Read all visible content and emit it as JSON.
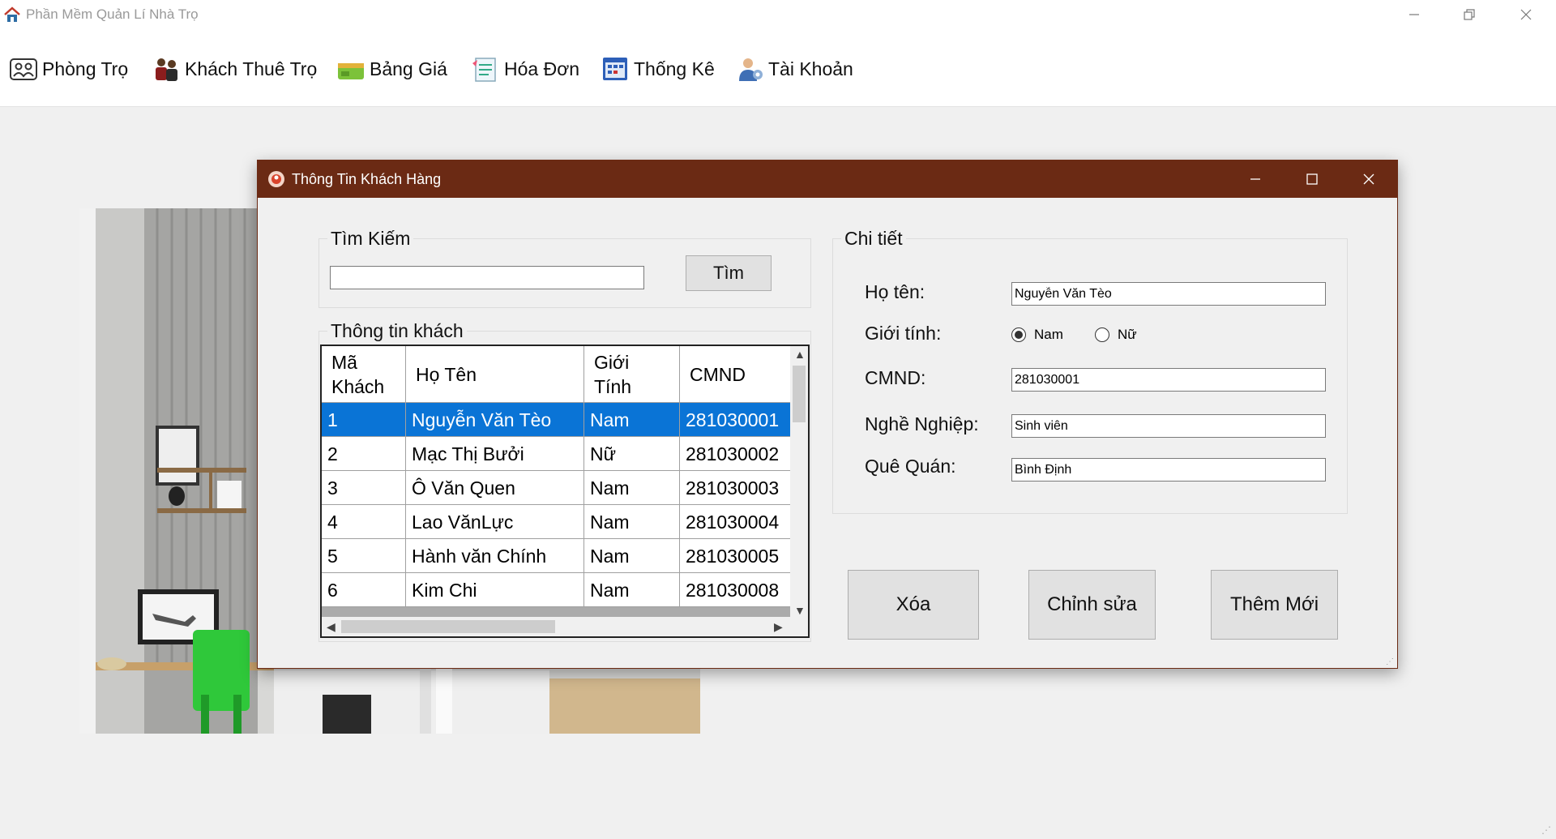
{
  "app": {
    "title": "Phần Mềm Quản Lí Nhà Trọ"
  },
  "menu": {
    "items": [
      {
        "label": "Phòng Trọ",
        "icon": "rooms-icon"
      },
      {
        "label": "Khách Thuê Trọ",
        "icon": "tenants-icon"
      },
      {
        "label": "Bảng Giá",
        "icon": "price-list-icon"
      },
      {
        "label": "Hóa Đơn",
        "icon": "invoice-icon"
      },
      {
        "label": "Thống Kê",
        "icon": "statistics-icon"
      },
      {
        "label": "Tài Khoản",
        "icon": "account-icon"
      }
    ]
  },
  "dialog": {
    "title": "Thông Tin Khách Hàng",
    "accent_color": "#6b2a14",
    "search": {
      "group_label": "Tìm Kiếm",
      "value": "",
      "button_label": "Tìm"
    },
    "guests": {
      "group_label": "Thông tin khách",
      "columns": [
        "Mã Khách",
        "Họ Tên",
        "Giới Tính",
        "CMND"
      ],
      "rows": [
        {
          "id": "1",
          "name": "Nguyễn Văn Tèo",
          "gender": "Nam",
          "cmnd": "281030001"
        },
        {
          "id": "2",
          "name": "Mạc Thị Bưởi",
          "gender": "Nữ",
          "cmnd": "281030002"
        },
        {
          "id": "3",
          "name": "Ô Văn Quen",
          "gender": "Nam",
          "cmnd": "281030003"
        },
        {
          "id": "4",
          "name": "Lao VănLực",
          "gender": "Nam",
          "cmnd": "281030004"
        },
        {
          "id": "5",
          "name": "Hành văn Chính",
          "gender": "Nam",
          "cmnd": "281030005"
        },
        {
          "id": "6",
          "name": "Kim Chi",
          "gender": "Nam",
          "cmnd": "281030008"
        }
      ],
      "selected_row": "1",
      "selection_color": "#0a74d6"
    },
    "details": {
      "group_label": "Chi tiết",
      "name_label": "Họ tên:",
      "name_value": "Nguyễn Văn Tèo",
      "gender_label": "Giới tính:",
      "gender_options": [
        "Nam",
        "Nữ"
      ],
      "gender_selected": "Nam",
      "cmnd_label": "CMND:",
      "cmnd_value": "281030001",
      "job_label": "Nghề Nghiệp:",
      "job_value": "Sinh viên",
      "hometown_label": "Quê Quán:",
      "hometown_value": "Bình Định"
    },
    "actions": {
      "delete_label": "Xóa",
      "edit_label": "Chỉnh sửa",
      "add_label": "Thêm Mới"
    }
  }
}
